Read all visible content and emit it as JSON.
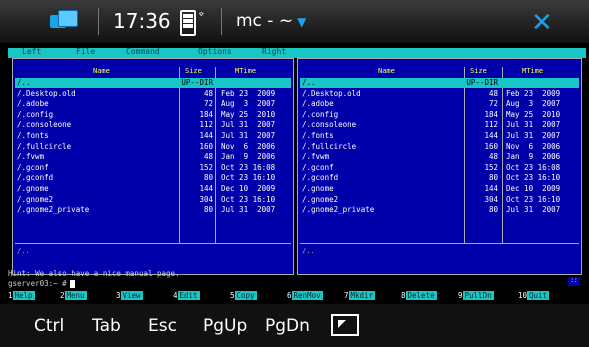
{
  "status": {
    "time": "17:36",
    "title": "mc - ~"
  },
  "menu": [
    "Left",
    "File",
    "Command",
    "Options",
    "Right"
  ],
  "columns": {
    "name": "Name",
    "size": "Size",
    "mtime": "MTime"
  },
  "left_panel": {
    "rows": [
      {
        "name": "/..",
        "size": "UP--DIR",
        "date": ""
      },
      {
        "name": "/.Desktop.old",
        "size": "48",
        "date": "Feb 23  2009"
      },
      {
        "name": "/.adobe",
        "size": "72",
        "date": "Aug  3  2007"
      },
      {
        "name": "/.config",
        "size": "184",
        "date": "May 25  2010"
      },
      {
        "name": "/.consoleone",
        "size": "112",
        "date": "Jul 31  2007"
      },
      {
        "name": "/.fonts",
        "size": "144",
        "date": "Jul 31  2007"
      },
      {
        "name": "/.fullcircle",
        "size": "160",
        "date": "Nov  6  2006"
      },
      {
        "name": "/.fvwm",
        "size": "48",
        "date": "Jan  9  2006"
      },
      {
        "name": "/.gconf",
        "size": "152",
        "date": "Oct 23 16:08"
      },
      {
        "name": "/.gconfd",
        "size": "80",
        "date": "Oct 23 16:10"
      },
      {
        "name": "/.gnome",
        "size": "144",
        "date": "Dec 10  2009"
      },
      {
        "name": "/.gnome2",
        "size": "304",
        "date": "Oct 23 16:10"
      },
      {
        "name": "/.gnome2_private",
        "size": "80",
        "date": "Jul 31  2007"
      }
    ],
    "mini": "/.."
  },
  "right_panel": {
    "rows": [
      {
        "name": "/..",
        "size": "UP--DIR",
        "date": ""
      },
      {
        "name": "/.Desktop.old",
        "size": "48",
        "date": "Feb 23  2009"
      },
      {
        "name": "/.adobe",
        "size": "72",
        "date": "Aug  3  2007"
      },
      {
        "name": "/.config",
        "size": "184",
        "date": "May 25  2010"
      },
      {
        "name": "/.consoleone",
        "size": "112",
        "date": "Jul 31  2007"
      },
      {
        "name": "/.fonts",
        "size": "144",
        "date": "Jul 31  2007"
      },
      {
        "name": "/.fullcircle",
        "size": "160",
        "date": "Nov  6  2006"
      },
      {
        "name": "/.fvwm",
        "size": "48",
        "date": "Jan  9  2006"
      },
      {
        "name": "/.gconf",
        "size": "152",
        "date": "Oct 23 16:08"
      },
      {
        "name": "/.gconfd",
        "size": "80",
        "date": "Oct 23 16:10"
      },
      {
        "name": "/.gnome",
        "size": "144",
        "date": "Dec 10  2009"
      },
      {
        "name": "/.gnome2",
        "size": "304",
        "date": "Oct 23 16:10"
      },
      {
        "name": "/.gnome2_private",
        "size": "80",
        "date": "Jul 31  2007"
      }
    ],
    "mini": "/.."
  },
  "hint": "Hint: We also have a nice manual page.",
  "prompt": "gserver03:~ #",
  "fkeys": [
    {
      "num": "1",
      "label": "Help"
    },
    {
      "num": "2",
      "label": "Menu"
    },
    {
      "num": "3",
      "label": "View"
    },
    {
      "num": "4",
      "label": "Edit"
    },
    {
      "num": "5",
      "label": "Copy"
    },
    {
      "num": "6",
      "label": "RenMov"
    },
    {
      "num": "7",
      "label": "Mkdir"
    },
    {
      "num": "8",
      "label": "Delete"
    },
    {
      "num": "9",
      "label": "PullDn"
    },
    {
      "num": "10",
      "label": "Quit"
    }
  ],
  "bottom_keys": [
    "Ctrl",
    "Tab",
    "Esc",
    "PgUp",
    "PgDn"
  ]
}
